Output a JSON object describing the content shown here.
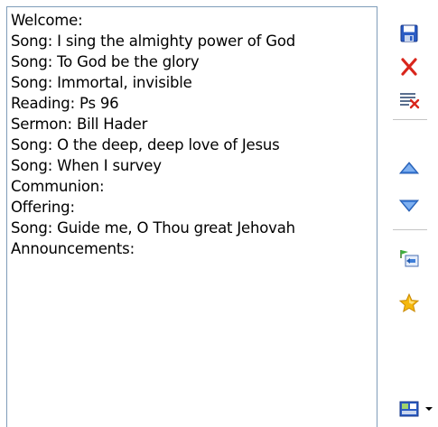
{
  "order_list": {
    "items": [
      "Welcome:",
      "Song: I sing the almighty power of God",
      "Song: To God be the glory",
      "Song: Immortal, invisible",
      "Reading: Ps 96",
      "Sermon: Bill Hader",
      "Song: O the deep, deep love of Jesus",
      "Song: When I survey",
      "Communion:",
      "Offering:",
      "Song: Guide me, O Thou great Jehovah",
      "Announcements:"
    ]
  },
  "toolbar": {
    "buttons": [
      {
        "icon": "save-icon"
      },
      {
        "icon": "delete-icon"
      },
      {
        "icon": "clear-list-icon"
      },
      {
        "icon": "move-up-icon"
      },
      {
        "icon": "move-down-icon"
      },
      {
        "icon": "insert-item-icon"
      },
      {
        "icon": "favorite-star-icon"
      },
      {
        "icon": "templates-dropdown-icon"
      }
    ]
  },
  "colors": {
    "border": "#7f9db9",
    "save_blue": "#2b5cc4",
    "delete_red": "#d9261c",
    "arrow_blue": "#3f7fd9",
    "star_gold": "#f5b80d"
  }
}
